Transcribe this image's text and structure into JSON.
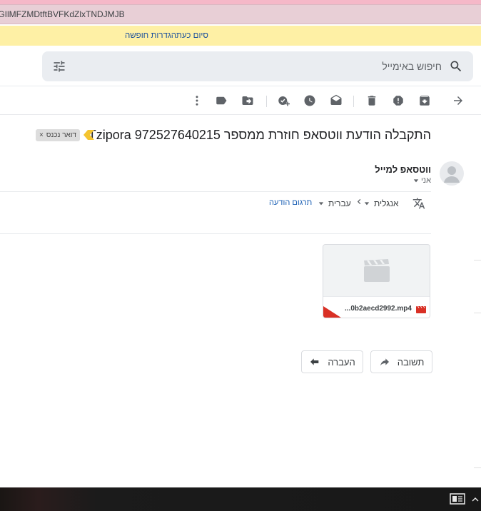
{
  "browser": {
    "url_fragment": ":GIlMFZMDtftBVFKdZlxTNDJMJB"
  },
  "vacation_bar": {
    "end_now": "סיום כעת",
    "settings": "הגדרות חופשה"
  },
  "search": {
    "placeholder": "חיפוש באימייל"
  },
  "message": {
    "subject": "התקבלה הודעת ווטסאפ חוזרת ממספר Tzipora 972527640215",
    "label": "דואר נכנס",
    "label_close": "×",
    "sender": "ווטסאפ למייל",
    "to": "אני"
  },
  "translate": {
    "from_lang": "אנגלית",
    "to_lang": "עברית",
    "translate_link": "תרגום הודעה"
  },
  "attachment": {
    "filename": "...0b2aecd2992.mp4"
  },
  "actions": {
    "reply": "תשובה",
    "forward": "העברה"
  },
  "icons": [
    "search-icon",
    "tune-icon",
    "back-arrow-icon",
    "archive-icon",
    "report-spam-icon",
    "delete-icon",
    "mark-unread-icon",
    "snooze-icon",
    "add-task-icon",
    "move-to-icon",
    "label-icon",
    "more-icon",
    "importance-icon",
    "avatar-icon",
    "translate-icon",
    "video-file-icon",
    "reply-icon",
    "forward-icon",
    "task-view-icon",
    "chevron-up-icon"
  ],
  "colors": {
    "vacation_bg": "#fef0a5",
    "accent_link": "#1a4f9c",
    "attachment_red": "#d93025",
    "importance": "#f4c430"
  }
}
